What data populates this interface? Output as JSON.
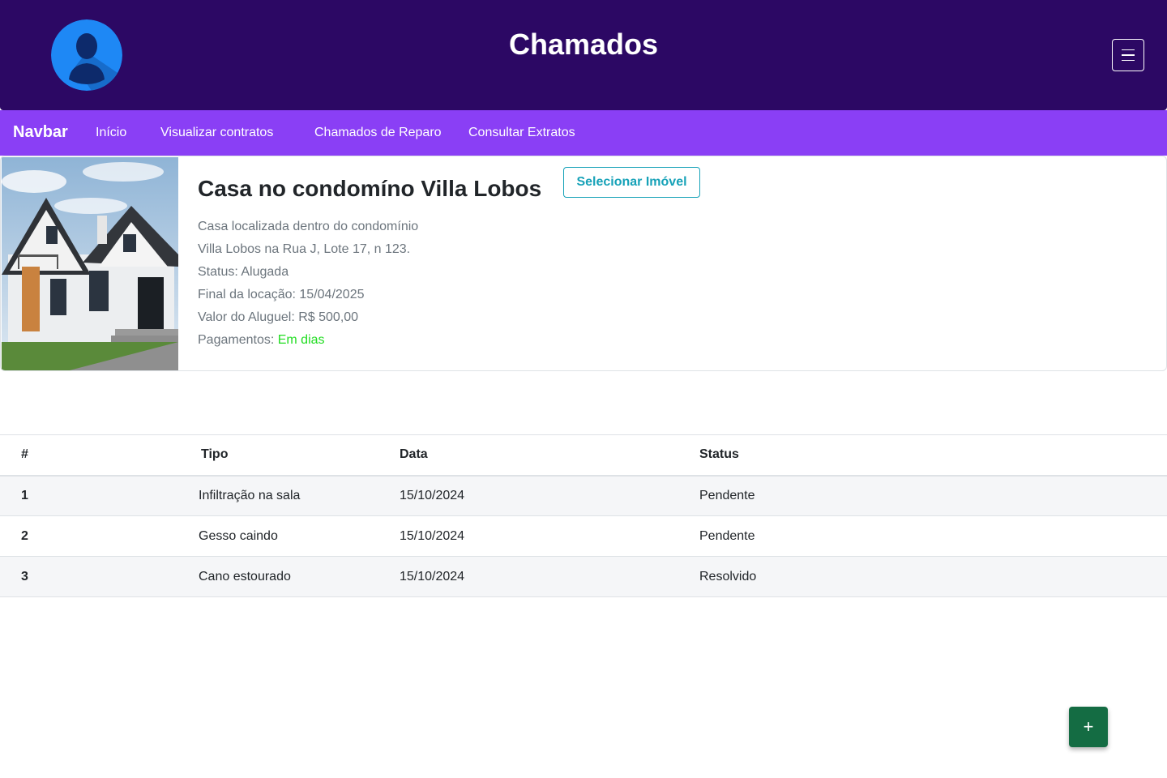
{
  "header": {
    "title": "Chamados",
    "avatar_icon": "user-silhouette-icon",
    "menu_icon": "hamburger-menu-icon"
  },
  "navbar": {
    "brand": "Navbar",
    "links": [
      "Início",
      "Visualizar contratos",
      "Chamados de Reparo",
      "Consultar Extratos"
    ]
  },
  "property": {
    "title": "Casa no condomíno Villa Lobos",
    "select_button": "Selecionar Imóvel",
    "description_line1": "Casa localizada dentro do condomínio",
    "description_line2": "Villa Lobos na Rua J, Lote 17, n 123.",
    "status": "Status: Alugada",
    "lease_end": "Final da locação: 15/04/2025",
    "rent": "Valor do Aluguel: R$ 500,00",
    "payments_label": "Pagamentos:",
    "payments_value": "Em dias"
  },
  "table": {
    "headers": [
      "#",
      "Tipo",
      "Data",
      "Status"
    ],
    "rows": [
      {
        "num": "1",
        "tipo": "Infiltração na sala",
        "data": "15/10/2024",
        "status": "Pendente"
      },
      {
        "num": "2",
        "tipo": "Gesso caindo",
        "data": "15/10/2024",
        "status": "Pendente"
      },
      {
        "num": "3",
        "tipo": "Cano estourado",
        "data": "15/10/2024",
        "status": "Resolvido"
      }
    ]
  },
  "fab": {
    "label": "+",
    "icon": "plus-icon"
  },
  "colors": {
    "header_bg": "#2c0864",
    "navbar_bg": "#8a3ff5",
    "pending": "#e00000",
    "resolved": "#22dd22",
    "fab_bg": "#146c43",
    "outline_button": "#17a2b8"
  }
}
